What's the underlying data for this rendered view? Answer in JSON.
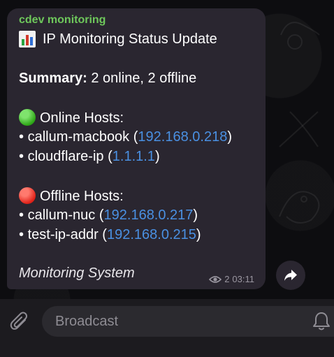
{
  "message": {
    "channel_name": "cdev monitoring",
    "title": "IP Monitoring Status Update",
    "summary_label": "Summary:",
    "summary_value": "2 online, 2 offline",
    "online_heading": "Online Hosts:",
    "online_hosts": [
      {
        "bullet": "•",
        "name": "callum-macbook",
        "ip": "192.168.0.218"
      },
      {
        "bullet": "•",
        "name": "cloudflare-ip",
        "ip": "1.1.1.1"
      }
    ],
    "offline_heading": "Offline Hosts:",
    "offline_hosts": [
      {
        "bullet": "•",
        "name": "callum-nuc",
        "ip": "192.168.0.217"
      },
      {
        "bullet": "•",
        "name": "test-ip-addr",
        "ip": "192.168.0.215"
      }
    ],
    "signature": "Monitoring System",
    "views": "2",
    "time": "03:11"
  },
  "input": {
    "placeholder": "Broadcast"
  },
  "colors": {
    "channel_name": "#6ec75b",
    "link": "#4a90e2",
    "bubble": "#2a2630",
    "input_bar": "#1c1b1f"
  },
  "icons": {
    "title": "bar-chart-icon",
    "online": "green-circle-icon",
    "offline": "red-circle-icon",
    "views": "eye-icon",
    "forward": "share-forward-icon",
    "attach": "paperclip-icon",
    "notify": "bell-icon"
  }
}
